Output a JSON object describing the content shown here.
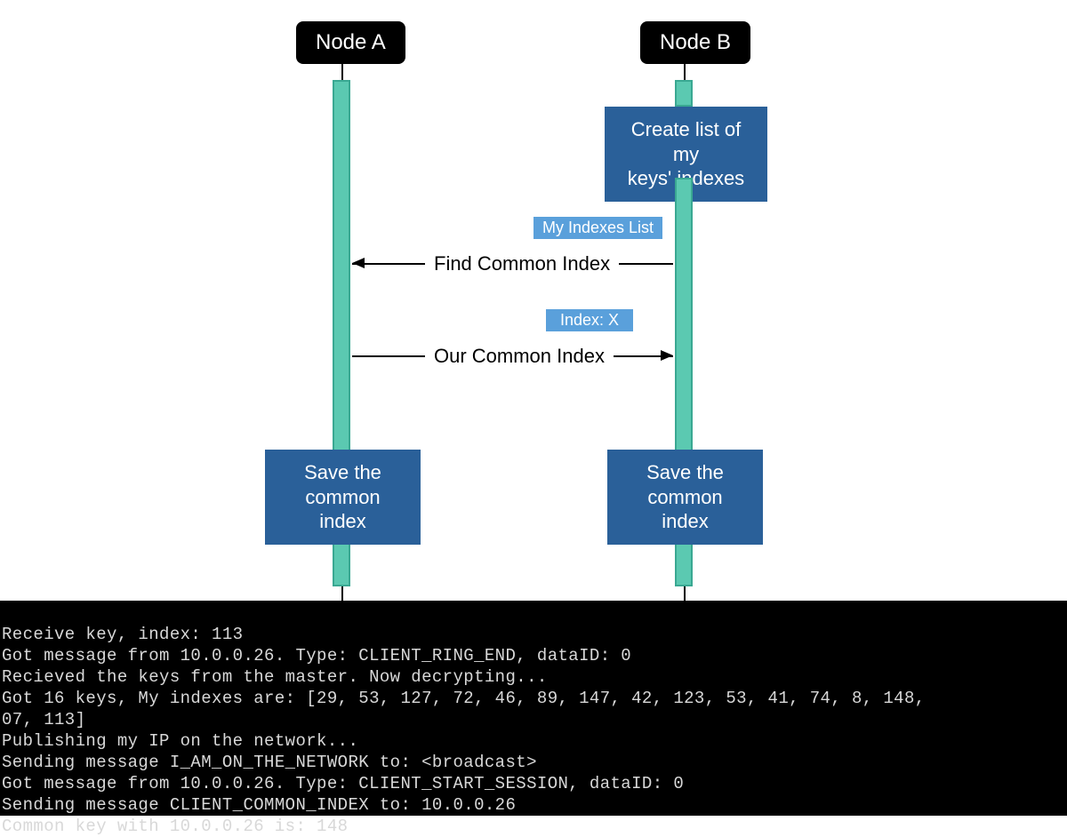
{
  "nodeA": {
    "label": "Node A"
  },
  "nodeB": {
    "label": "Node B"
  },
  "actions": {
    "createList": "Create list of my\nkeys' indexes",
    "saveA": "Save the\ncommon index",
    "saveB": "Save the\ncommon index"
  },
  "messages": {
    "findCommon": "Find Common Index",
    "ourCommon": "Our Common Index"
  },
  "tags": {
    "myIndexes": "My Indexes List",
    "indexX": "Index: X"
  },
  "terminal": {
    "lines": [
      "Receive key, index: 113",
      "Got message from 10.0.0.26. Type: CLIENT_RING_END, dataID: 0",
      "Recieved the keys from the master. Now decrypting...",
      "Got 16 keys, My indexes are: [29, 53, 127, 72, 46, 89, 147, 42, 123, 53, 41, 74, 8, 148,",
      "07, 113]",
      "Publishing my IP on the network...",
      "Sending message I_AM_ON_THE_NETWORK to: <broadcast>",
      "Got message from 10.0.0.26. Type: CLIENT_START_SESSION, dataID: 0",
      "Sending message CLIENT_COMMON_INDEX to: 10.0.0.26",
      "Common key with 10.0.0.26 is: 148"
    ]
  }
}
